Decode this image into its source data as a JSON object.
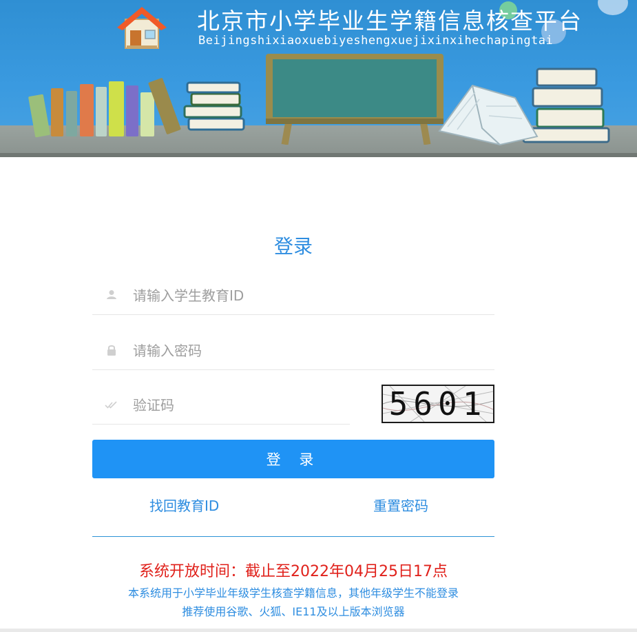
{
  "header": {
    "title": "北京市小学毕业生学籍信息核查平台",
    "subtitle": "Beijingshixiaoxuebiyeshengxuejixinxihechapingtai"
  },
  "login": {
    "title": "登录",
    "student_id_placeholder": "请输入学生教育ID",
    "password_placeholder": "请输入密码",
    "captcha_placeholder": "验证码",
    "captcha_code": "5601",
    "submit_label": "登 录"
  },
  "links": {
    "find_id": "找回教育ID",
    "reset_password": "重置密码"
  },
  "notice": {
    "open_time": "系统开放时间：截止至2022年04月25日17点",
    "scope": "本系统用于小学毕业年级学生核查学籍信息，其他年级学生不能登录",
    "browsers": "推荐使用谷歌、火狐、IE11及以上版本浏览器"
  },
  "colors": {
    "accent": "#1f93f5",
    "link": "#2e8de0",
    "warning": "#e0211b",
    "banner": "#3a9ae0"
  },
  "icons": {
    "student_id": "user-icon",
    "password": "lock-icon",
    "captcha": "check-icon",
    "header": "house-icon"
  }
}
